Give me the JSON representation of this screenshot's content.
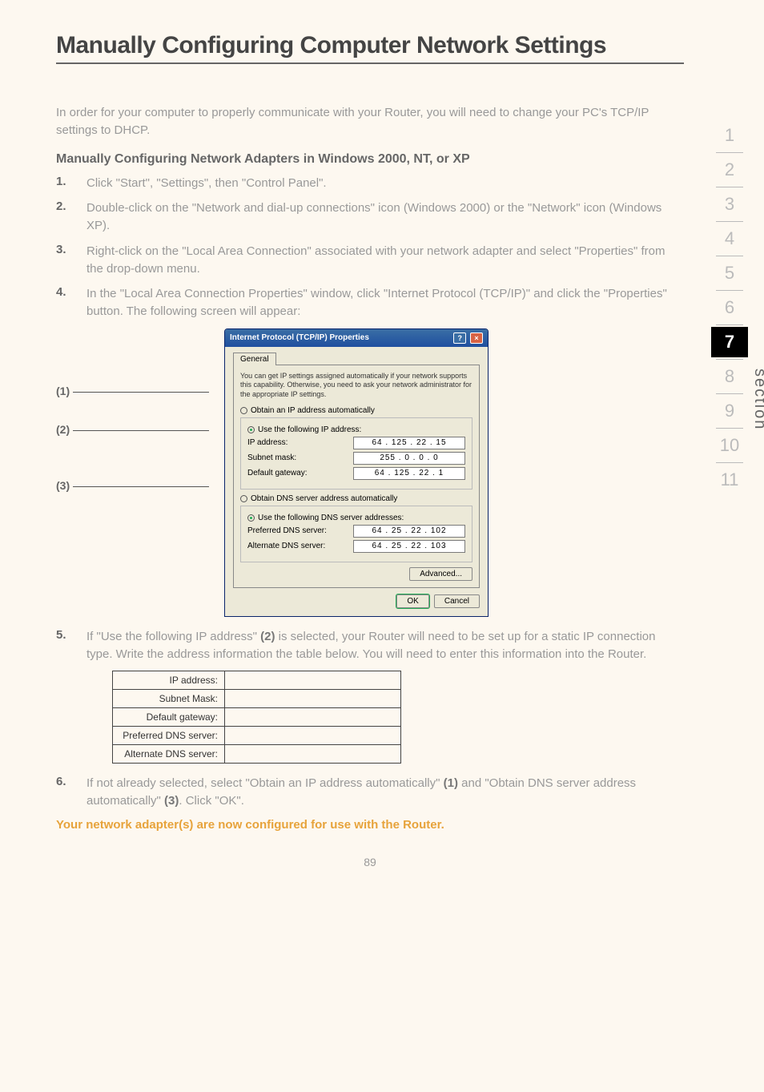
{
  "title": "Manually Configuring Computer Network Settings",
  "intro": "In order for your computer to properly communicate with your Router, you will need to change your PC's TCP/IP settings to DHCP.",
  "subhead": "Manually Configuring Network Adapters in Windows 2000, NT, or XP",
  "steps": {
    "s1": {
      "num": "1.",
      "text": "Click \"Start\", \"Settings\", then \"Control Panel\"."
    },
    "s2": {
      "num": "2.",
      "text": "Double-click on the \"Network and dial-up connections\" icon (Windows 2000) or the \"Network\" icon (Windows XP)."
    },
    "s3": {
      "num": "3.",
      "text": "Right-click on the \"Local Area Connection\" associated with your network adapter and select \"Properties\" from the drop-down menu."
    },
    "s4": {
      "num": "4.",
      "text": "In the \"Local Area Connection Properties\" window, click \"Internet Protocol (TCP/IP)\" and click the \"Properties\" button. The following screen will appear:"
    },
    "s5": {
      "num": "5.",
      "pre": "If \"Use the following IP address\" ",
      "ref": "(2)",
      "post": " is selected, your Router will need to be set up for a static IP connection type. Write the address information the table below. You will need to enter this information into the Router."
    },
    "s6": {
      "num": "6.",
      "pre": "If not already selected, select \"Obtain an IP address automatically\" ",
      "ref1": "(1)",
      "mid": " and \"Obtain DNS server address automatically\" ",
      "ref2": "(3)",
      "post": ". Click \"OK\"."
    }
  },
  "callouts": {
    "c1": "(1)",
    "c2": "(2)",
    "c3": "(3)"
  },
  "dialog": {
    "title": "Internet Protocol (TCP/IP) Properties",
    "tab": "General",
    "desc": "You can get IP settings assigned automatically if your network supports this capability. Otherwise, you need to ask your network administrator for the appropriate IP settings.",
    "r1": "Obtain an IP address automatically",
    "r2": "Use the following IP address:",
    "ip_label": "IP address:",
    "ip_val": "64 . 125 . 22 . 15",
    "mask_label": "Subnet mask:",
    "mask_val": "255 . 0 . 0 . 0",
    "gw_label": "Default gateway:",
    "gw_val": "64 . 125 . 22 . 1",
    "r3": "Obtain DNS server address automatically",
    "r4": "Use the following DNS server addresses:",
    "pdns_label": "Preferred DNS server:",
    "pdns_val": "64 . 25 . 22 . 102",
    "adns_label": "Alternate DNS server:",
    "adns_val": "64 . 25 . 22 . 103",
    "advanced": "Advanced...",
    "ok": "OK",
    "cancel": "Cancel"
  },
  "blank_table": {
    "r1": "IP address:",
    "r2": "Subnet Mask:",
    "r3": "Default gateway:",
    "r4": "Preferred DNS server:",
    "r5": "Alternate DNS server:"
  },
  "closing": "Your network adapter(s) are now configured for use with the Router.",
  "sidenav": [
    "1",
    "2",
    "3",
    "4",
    "5",
    "6",
    "7",
    "8",
    "9",
    "10",
    "11"
  ],
  "sidenav_active": "7",
  "section_label": "section",
  "page_number": "89"
}
